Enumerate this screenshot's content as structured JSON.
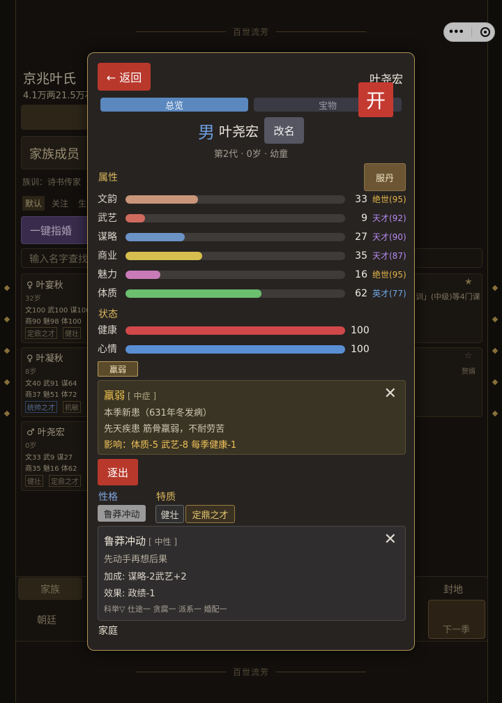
{
  "background": {
    "header_deco": "百世流芳",
    "footer_deco": "百世流芳",
    "family_name": "京兆叶氏",
    "family_wealth": "4.1万两21.5万石",
    "section_members": "家族成员",
    "motto": "族训：诗书传家",
    "filters": [
      "默认",
      "关注",
      "生"
    ],
    "btn_marry": "一键指婚",
    "search_placeholder": "输入名字查找",
    "members": [
      {
        "name": "叶宴秋",
        "age": "32岁",
        "stats1": "文100 武100 谋100",
        "stats2": "商90 魅98 体100",
        "tags": [
          "定鼎之才",
          "健壮"
        ]
      },
      {
        "name": "叶凝秋",
        "age": "8岁",
        "stats1": "文40 武91 谋64",
        "stats2": "商37 魅51 体72",
        "tags": [
          "统帅之才",
          "机敏"
        ]
      },
      {
        "name": "叶尧宏",
        "age": "0岁",
        "stats1": "文33 武9 谋27",
        "stats2": "商35 魅16 体62",
        "tags": [
          "健壮",
          "定鼎之才"
        ]
      }
    ],
    "right_snippet": "训」(中级)等4门课",
    "right_snippet2": "赘婿",
    "bottom_tabs": [
      "家族",
      "朝廷",
      "封地"
    ],
    "next_season": "下一季"
  },
  "modal": {
    "back_label": "← 返回",
    "header_name": "叶尧宏",
    "kai_label": "开",
    "tabs": [
      "总览",
      "宝物"
    ],
    "gender": "男",
    "name": "叶尧宏",
    "rename_label": "改名",
    "subline": "第2代 · 0岁 · 幼童",
    "attributes_label": "属性",
    "pill_button": "服丹",
    "attributes": [
      {
        "label": "文韵",
        "value": 33,
        "talent": "绝世(95)",
        "color": "#c9967a",
        "talent_color": "#e2b64a"
      },
      {
        "label": "武艺",
        "value": 9,
        "talent": "天才(92)",
        "color": "#d06a5e",
        "talent_color": "#b58bf0"
      },
      {
        "label": "谋略",
        "value": 27,
        "talent": "天才(90)",
        "color": "#6b93c6",
        "talent_color": "#b58bf0"
      },
      {
        "label": "商业",
        "value": 35,
        "talent": "天才(87)",
        "color": "#d6bf4e",
        "talent_color": "#b58bf0"
      },
      {
        "label": "魅力",
        "value": 16,
        "talent": "绝世(95)",
        "color": "#c87bb8",
        "talent_color": "#e2b64a"
      },
      {
        "label": "体质",
        "value": 62,
        "talent": "英才(77)",
        "color": "#6bbf6f",
        "talent_color": "#6fa6e6"
      }
    ],
    "status_label": "状态",
    "status": [
      {
        "label": "健康",
        "value": 100,
        "color": "#d0484a"
      },
      {
        "label": "心情",
        "value": 100,
        "color": "#5a8fd4"
      }
    ],
    "illness_tag": "羸弱",
    "illness_card": {
      "title": "羸弱",
      "severity": "[ 中症 ]",
      "line1": "本季新患（631年冬发病）",
      "line2": "先天疾患  筋骨羸弱，不耐劳苦",
      "line3": "影响：体质-5  武艺-8  每季健康-1"
    },
    "exile_label": "逐出",
    "personality_label": "性格",
    "traits_label": "特质",
    "personality": "鲁莽冲动",
    "traits": [
      "健壮",
      "定鼎之才"
    ],
    "trait_card": {
      "title": "鲁莽冲动",
      "category": "[ 中性 ]",
      "line1": "先动手再想后果",
      "line2": "加成: 谋略-2武艺+2",
      "line3": "效果: 政绩-1",
      "influence": "科举▽  仕途一  贪腐一  派系一  婚配一"
    },
    "family_label": "家庭"
  }
}
